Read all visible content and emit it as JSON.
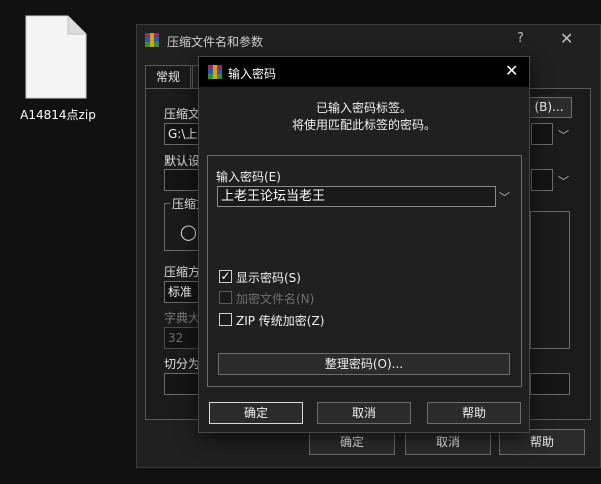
{
  "desktop": {
    "file_label": "A14814点zip"
  },
  "bg_dialog": {
    "title": "压缩文件名和参数",
    "help_glyph": "?",
    "close_glyph": "✕",
    "tab_general": "常规",
    "archive_name_label": "压缩文",
    "archive_path_value": "G:\\上传",
    "browse_label": "(B)...",
    "default_profile_label": "默认设",
    "archive_format_label": "压缩文",
    "radio_glyph": "◯",
    "method_label": "压缩方",
    "method_value": "标准",
    "dict_label": "字典大",
    "dict_value": "32",
    "split_label": "切分为",
    "ok_label": "确定",
    "cancel_label": "取消",
    "help_label": "帮助"
  },
  "pw_dialog": {
    "title": "输入密码",
    "close_glyph": "✕",
    "info_line1": "已输入密码标签。",
    "info_line2": "将使用匹配此标签的密码。",
    "enter_password_label": "输入密码(E)",
    "password_value": "上老王论坛当老王",
    "show_password_label": "显示密码(S)",
    "show_password_checked": true,
    "encrypt_names_label": "加密文件名(N)",
    "encrypt_names_checked": false,
    "zip_legacy_label": "ZIP 传统加密(Z)",
    "zip_legacy_checked": false,
    "check_glyph": "✓",
    "organize_label": "整理密码(O)...",
    "ok_label": "确定",
    "cancel_label": "取消",
    "help_label": "帮助"
  },
  "colors": {
    "background": "#111111",
    "dialog_bg": "#202020",
    "titlebar_bg": "#000000",
    "button_bg": "#2b2b2b",
    "border": "#6d6d6d"
  }
}
